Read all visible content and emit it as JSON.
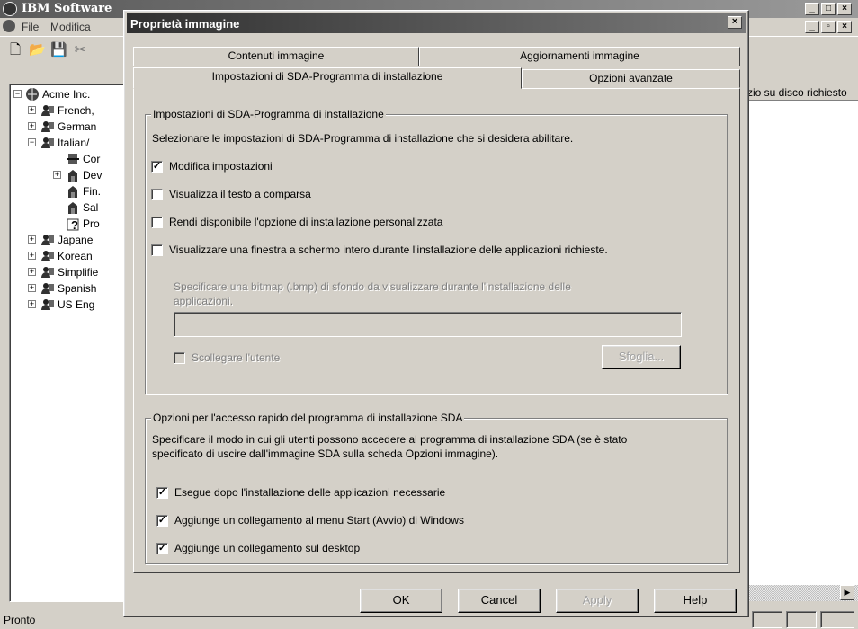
{
  "main_window": {
    "title": "IBM Software",
    "menu": [
      "File",
      "Modifica"
    ],
    "right_column_header": "zio su disco richiesto",
    "status": "Pronto"
  },
  "tree": {
    "root": "Acme Inc.",
    "items": [
      {
        "label": "French,",
        "expander": "+",
        "indent": 1,
        "icon": "user-group-icon"
      },
      {
        "label": "German",
        "expander": "+",
        "indent": 1,
        "icon": "user-group-icon"
      },
      {
        "label": "Italian/",
        "expander": "−",
        "indent": 1,
        "icon": "user-group-icon"
      },
      {
        "label": "Cor",
        "expander": "",
        "indent": 2,
        "icon": "config-icon"
      },
      {
        "label": "Dev",
        "expander": "+",
        "indent": 2,
        "icon": "building-icon"
      },
      {
        "label": "Fin.",
        "expander": "",
        "indent": 2,
        "icon": "building-icon"
      },
      {
        "label": "Sal",
        "expander": "",
        "indent": 2,
        "icon": "building-icon"
      },
      {
        "label": "Pro",
        "expander": "",
        "indent": 2,
        "icon": "question-icon"
      },
      {
        "label": "Japane",
        "expander": "+",
        "indent": 1,
        "icon": "user-group-icon"
      },
      {
        "label": "Korean",
        "expander": "+",
        "indent": 1,
        "icon": "user-group-icon"
      },
      {
        "label": "Simplifie",
        "expander": "+",
        "indent": 1,
        "icon": "user-group-icon"
      },
      {
        "label": "Spanish",
        "expander": "+",
        "indent": 1,
        "icon": "user-group-icon"
      },
      {
        "label": "US Eng",
        "expander": "+",
        "indent": 1,
        "icon": "user-group-icon"
      }
    ]
  },
  "dialog": {
    "title": "Proprietà immagine",
    "close": "×",
    "tabs_back": [
      "Contenuti immagine",
      "Aggiornamenti immagine"
    ],
    "tabs_front": [
      "Impostazioni di SDA-Programma di installazione",
      "Opzioni avanzate"
    ],
    "group1": {
      "legend": "Impostazioni di SDA-Programma di installazione",
      "intro": "Selezionare le impostazioni di SDA-Programma di installazione che si desidera abilitare.",
      "checkboxes": [
        {
          "label": "Modifica impostazioni",
          "checked": true
        },
        {
          "label": "Visualizza il testo a comparsa",
          "checked": false
        },
        {
          "label": "Rendi disponibile l'opzione di installazione personalizzata",
          "checked": false
        },
        {
          "label": "Visualizzare una finestra a schermo intero durante l'installazione delle applicazioni richieste.",
          "checked": false
        }
      ],
      "bitmap_hint_line1": "Specificare una bitmap (.bmp) di sfondo da visualizzare durante l'installazione delle",
      "bitmap_hint_line2": "applicazioni.",
      "bitmap_value": "",
      "disconnect_label": "Scollegare l'utente",
      "browse_label": "Sfoglia..."
    },
    "group2": {
      "legend": "Opzioni per l'accesso rapido del programma di installazione SDA",
      "intro_line1": "Specificare il modo in cui gli utenti possono accedere al programma di installazione SDA (se è stato",
      "intro_line2": "specificato di uscire dall'immagine SDA sulla scheda Opzioni immagine).",
      "checkboxes": [
        {
          "label": "Esegue dopo l'installazione delle applicazioni necessarie",
          "checked": true
        },
        {
          "label": "Aggiunge un collegamento al menu Start (Avvio) di Windows",
          "checked": true
        },
        {
          "label": "Aggiunge un collegamento sul desktop",
          "checked": true
        }
      ]
    },
    "buttons": {
      "ok": "OK",
      "cancel": "Cancel",
      "apply": "Apply",
      "help": "Help"
    }
  }
}
